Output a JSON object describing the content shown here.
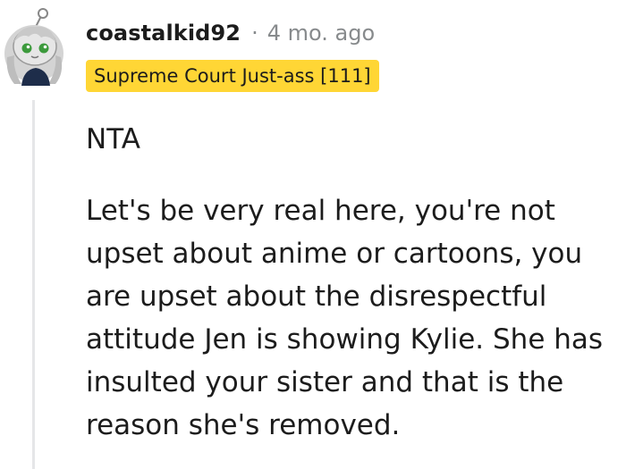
{
  "comment": {
    "author": "coastalkid92",
    "separator": "·",
    "timestamp": "4 mo. ago",
    "flair": "Supreme Court Just-ass [111]",
    "paragraphs": [
      "NTA",
      "Let's be very real here, you're not upset about anime or cartoons, you are upset about the disrespectful attitude Jen is showing Kylie. She has insulted your sister and that is the reason she's removed."
    ],
    "avatar_icon": "snoo-avatar-icon",
    "colors": {
      "flair_bg": "#ffd635",
      "thread_line": "#e5e6e8",
      "meta_text": "#878a8c",
      "body_text": "#1c1c1c"
    }
  }
}
